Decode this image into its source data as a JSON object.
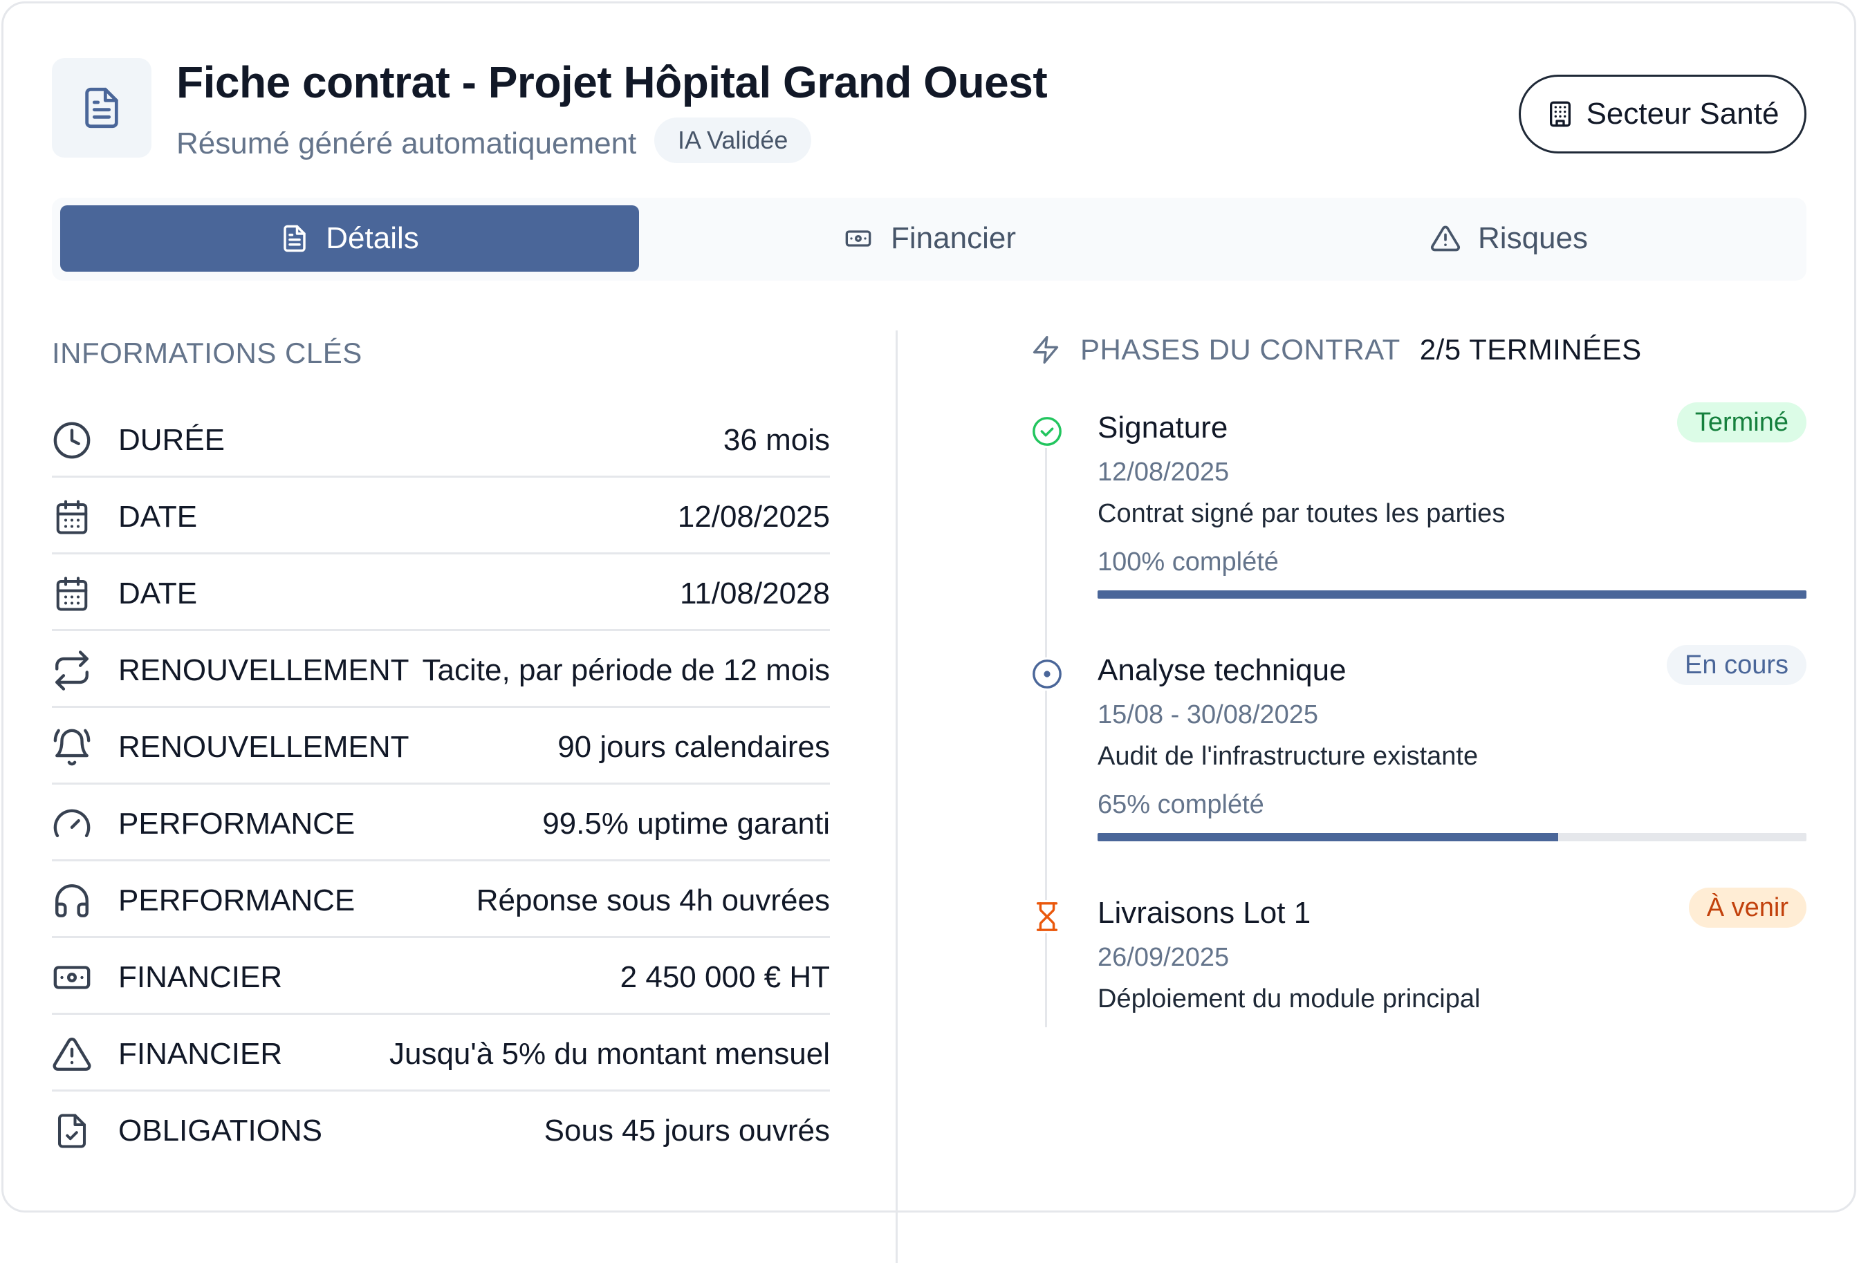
{
  "header": {
    "title": "Fiche contrat - Projet Hôpital Grand Ouest",
    "subtitle": "Résumé généré automatiquement",
    "ia_badge": "IA Validée",
    "sector_button": "Secteur Santé"
  },
  "tabs": [
    {
      "label": "Détails",
      "icon": "document-icon",
      "active": true
    },
    {
      "label": "Financier",
      "icon": "banknote-icon",
      "active": false
    },
    {
      "label": "Risques",
      "icon": "warning-icon",
      "active": false
    }
  ],
  "info": {
    "title": "INFORMATIONS CLÉS",
    "rows": [
      {
        "icon": "clock-icon",
        "label": "DURÉE",
        "value": "36 mois"
      },
      {
        "icon": "calendar-icon",
        "label": "DATE",
        "value": "12/08/2025"
      },
      {
        "icon": "calendar-icon",
        "label": "DATE",
        "value": "11/08/2028"
      },
      {
        "icon": "repeat-icon",
        "label": "RENOUVELLEMENT",
        "value": "Tacite, par période de 12 mois"
      },
      {
        "icon": "alarm-icon",
        "label": "RENOUVELLEMENT",
        "value": "90 jours calendaires"
      },
      {
        "icon": "gauge-icon",
        "label": "PERFORMANCE",
        "value": "99.5% uptime garanti"
      },
      {
        "icon": "headphones-icon",
        "label": "PERFORMANCE",
        "value": "Réponse sous 4h ouvrées"
      },
      {
        "icon": "banknote-icon",
        "label": "FINANCIER",
        "value": "2 450 000 € HT"
      },
      {
        "icon": "warning-icon",
        "label": "FINANCIER",
        "value": "Jusqu'à 5% du montant mensuel"
      },
      {
        "icon": "file-check-icon",
        "label": "OBLIGATIONS",
        "value": "Sous 45 jours ouvrés"
      }
    ]
  },
  "phases": {
    "title": "PHASES DU CONTRAT",
    "count": "2/5 TERMINÉES",
    "items": [
      {
        "name": "Signature",
        "date": "12/08/2025",
        "description": "Contrat signé par toutes les parties",
        "progress_label": "100% complété",
        "progress": 1.0,
        "status": "Terminé",
        "status_color": "#15803d",
        "icon": "check-circle-icon"
      },
      {
        "name": "Analyse technique",
        "date": "15/08 - 30/08/2025",
        "description": "Audit de l'infrastructure existante",
        "progress_label": "65% complété",
        "progress": 0.65,
        "status": "En cours",
        "status_color": "#4a6699",
        "icon": "dot-circle-icon"
      },
      {
        "name": "Livraisons Lot 1",
        "date": "26/09/2025",
        "description": "Déploiement du module principal",
        "status": "À venir",
        "status_color": "#c2410c",
        "icon": "hourglass-icon"
      }
    ]
  },
  "colors": {
    "accent": "#4a6699",
    "success": "#15803d",
    "warning": "#ea580c",
    "muted": "#64748b"
  }
}
